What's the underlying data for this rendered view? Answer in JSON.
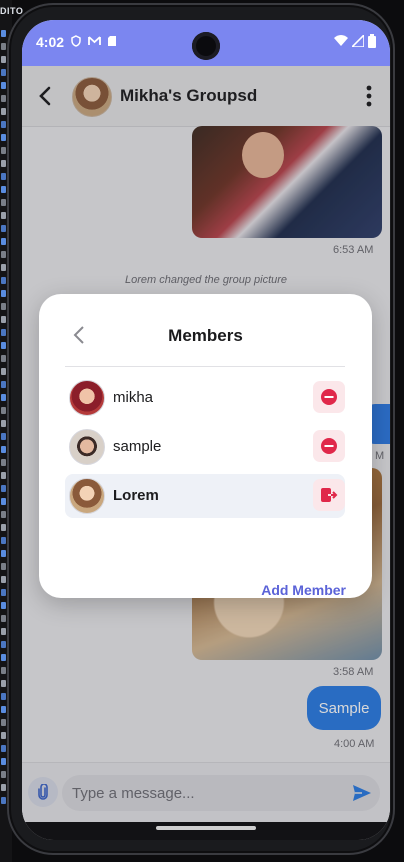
{
  "editor": {
    "label": "DITO"
  },
  "status_bar": {
    "time": "4:02",
    "left_icons": [
      "shield-icon",
      "gmail-icon",
      "sd-card-icon"
    ],
    "right_icons": [
      "wifi-icon",
      "signal-icon",
      "battery-icon"
    ]
  },
  "header": {
    "title": "Mikha's Groupsd"
  },
  "chat": {
    "photo1_time": "6:53 AM",
    "system_message": "Lorem changed the group picture",
    "partial_time": "M",
    "photo2_time": "3:58 AM",
    "sent_message": "Sample",
    "sent_time": "4:00 AM"
  },
  "input": {
    "placeholder": "Type a message..."
  },
  "members_dialog": {
    "title": "Members",
    "members": [
      {
        "name": "mikha",
        "action": "remove"
      },
      {
        "name": "sample",
        "action": "remove"
      },
      {
        "name": "Lorem",
        "action": "leave"
      }
    ],
    "add_member_label": "Add Member"
  },
  "colors": {
    "accent": "#7b86f0",
    "sent_bubble": "#2a7ce3",
    "danger": "#e0284a",
    "link": "#5b63d8"
  }
}
